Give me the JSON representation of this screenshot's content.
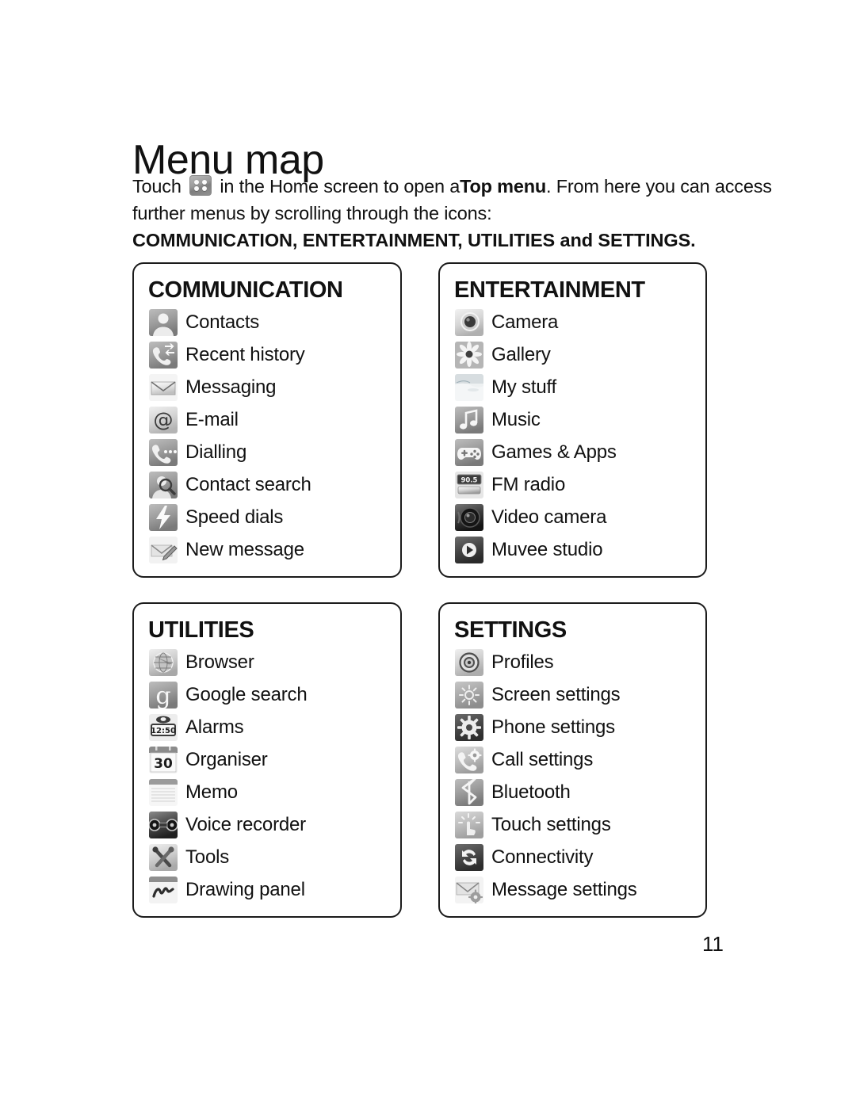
{
  "page": {
    "title": "Menu map",
    "page_number": "11"
  },
  "intro": {
    "line1_before_icon": "Touch",
    "icon": "top-menu-grid-icon",
    "line1_after_icon_a": "in the Home screen to open a",
    "line1_bold": "Top menu",
    "line1_after_icon_b": ". From here you can access",
    "line2": "further menus by scrolling through the icons:",
    "line3": "COMMUNICATION, ENTERTAINMENT, UTILITIES and SETTINGS."
  },
  "panels": [
    {
      "id": "communication",
      "title": "COMMUNICATION",
      "items": [
        {
          "label": "Contacts",
          "icon": "contacts-icon"
        },
        {
          "label": "Recent history",
          "icon": "recent-history-icon"
        },
        {
          "label": "Messaging",
          "icon": "messaging-envelope-icon"
        },
        {
          "label": "E-mail",
          "icon": "email-at-icon"
        },
        {
          "label": "Dialling",
          "icon": "dialling-handset-icon"
        },
        {
          "label": "Contact search",
          "icon": "contact-search-icon"
        },
        {
          "label": "Speed dials",
          "icon": "speed-dials-bolt-icon"
        },
        {
          "label": "New message",
          "icon": "new-message-pen-icon"
        }
      ]
    },
    {
      "id": "entertainment",
      "title": "ENTERTAINMENT",
      "items": [
        {
          "label": "Camera",
          "icon": "camera-lens-icon"
        },
        {
          "label": "Gallery",
          "icon": "gallery-flower-icon"
        },
        {
          "label": "My stuff",
          "icon": "my-stuff-landscape-icon"
        },
        {
          "label": "Music",
          "icon": "music-note-icon"
        },
        {
          "label": "Games & Apps",
          "icon": "games-gamepad-icon"
        },
        {
          "label": "FM radio",
          "icon": "fm-radio-icon",
          "display": "90.5"
        },
        {
          "label": "Video camera",
          "icon": "video-camera-icon"
        },
        {
          "label": "Muvee studio",
          "icon": "muvee-studio-play-icon"
        }
      ]
    },
    {
      "id": "utilities",
      "title": "UTILITIES",
      "items": [
        {
          "label": "Browser",
          "icon": "browser-globe-icon"
        },
        {
          "label": "Google search",
          "icon": "google-search-icon",
          "display": "g"
        },
        {
          "label": "Alarms",
          "icon": "alarm-clock-icon",
          "display": "12:50"
        },
        {
          "label": "Organiser",
          "icon": "organiser-calendar-icon",
          "display": "30"
        },
        {
          "label": "Memo",
          "icon": "memo-notepad-icon"
        },
        {
          "label": "Voice recorder",
          "icon": "voice-recorder-icon"
        },
        {
          "label": "Tools",
          "icon": "tools-icon"
        },
        {
          "label": "Drawing panel",
          "icon": "drawing-panel-icon"
        }
      ]
    },
    {
      "id": "settings",
      "title": "SETTINGS",
      "items": [
        {
          "label": "Profiles",
          "icon": "profiles-speaker-icon"
        },
        {
          "label": "Screen settings",
          "icon": "screen-settings-brightness-icon"
        },
        {
          "label": "Phone settings",
          "icon": "phone-settings-gear-icon"
        },
        {
          "label": "Call settings",
          "icon": "call-settings-icon"
        },
        {
          "label": "Bluetooth",
          "icon": "bluetooth-icon"
        },
        {
          "label": "Touch settings",
          "icon": "touch-settings-icon"
        },
        {
          "label": "Connectivity",
          "icon": "connectivity-sync-icon"
        },
        {
          "label": "Message settings",
          "icon": "message-settings-icon"
        }
      ]
    }
  ],
  "colors": {
    "text": "#111111",
    "panel_border": "#1b1b1b",
    "background": "#ffffff",
    "icon_light": "#d8d8d8",
    "icon_mid": "#9a9a9a",
    "icon_dark": "#4a4a4a"
  }
}
